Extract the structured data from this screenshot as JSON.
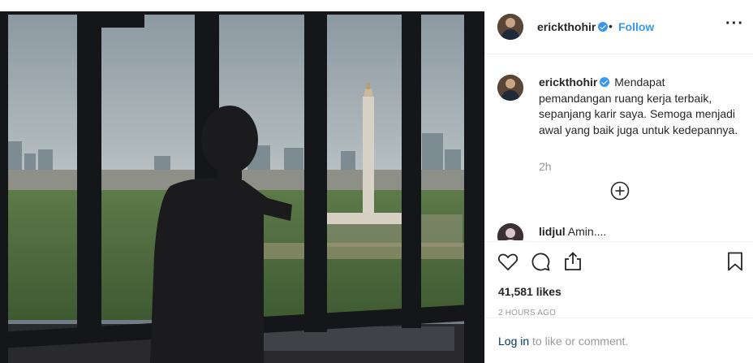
{
  "post": {
    "username": "erickthohir",
    "separator": "•",
    "follow_label": "Follow",
    "more_icon": "more-options-icon",
    "caption": "Mendapat pemandangan ruang kerja terbaik, sepanjang karir saya. Semoga menjadi awal yang baik juga untuk kedepannya.",
    "caption_time": "2h",
    "load_more_icon": "plus-circle-icon",
    "comments": [
      {
        "username": "lidjul",
        "text": "Amin...."
      }
    ],
    "likes": "41,581 likes",
    "posted_ago": "2 HOURS AGO",
    "login_prompt": {
      "link": "Log in",
      "rest": " to like or comment."
    },
    "action_icons": [
      "heart-icon",
      "comment-icon",
      "share-icon",
      "bookmark-icon"
    ]
  },
  "colors": {
    "accent": "#3897f0",
    "text": "#262626",
    "secondary": "#999999",
    "link": "#003569",
    "border": "#efefef"
  }
}
